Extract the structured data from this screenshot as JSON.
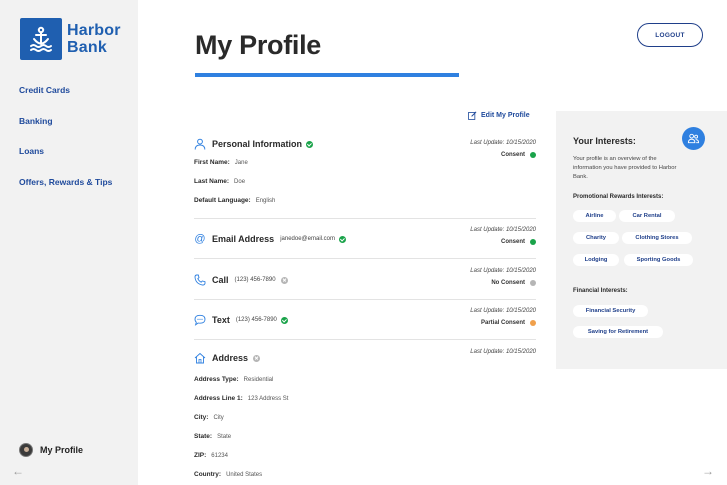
{
  "brand": {
    "line1": "Harbor",
    "line2": "Bank",
    "color": "#1f5fb0"
  },
  "sidebar": {
    "items": [
      {
        "label": "Credit Cards"
      },
      {
        "label": "Banking"
      },
      {
        "label": "Loans"
      },
      {
        "label": "Offers, Rewards & Tips"
      }
    ],
    "profile_label": "My Profile"
  },
  "header": {
    "title": "My Profile",
    "logout_label": "LOGOUT",
    "accent": "#2f80e0"
  },
  "edit_label": "Edit My Profile",
  "sections": {
    "personal": {
      "title": "Personal Information",
      "update": "Last Update: 10/15/2020",
      "consent": "Consent",
      "fields": [
        {
          "label": "First Name:",
          "value": "Jane"
        },
        {
          "label": "Last Name:",
          "value": "Doe"
        },
        {
          "label": "Default Language:",
          "value": "English"
        }
      ]
    },
    "email": {
      "title": "Email Address",
      "value": "janedoe@email.com",
      "update": "Last Update: 10/15/2020",
      "consent": "Consent"
    },
    "call": {
      "title": "Call",
      "value": "(123) 456-7890",
      "update": "Last Update: 10/15/2020",
      "consent": "No Consent"
    },
    "text": {
      "title": "Text",
      "value": "(123) 456-7890",
      "update": "Last Update: 10/15/2020",
      "consent": "Partial Consent"
    },
    "address": {
      "title": "Address",
      "update": "Last Update: 10/15/2020",
      "fields": [
        {
          "label": "Address Type:",
          "value": "Residential"
        },
        {
          "label": "Address Line 1:",
          "value": "123 Address St"
        },
        {
          "label": "City:",
          "value": "City"
        },
        {
          "label": "State:",
          "value": "State"
        },
        {
          "label": "ZIP:",
          "value": "61234"
        },
        {
          "label": "Country:",
          "value": "United States"
        }
      ]
    }
  },
  "status_colors": {
    "consent": "#1aa34a",
    "no_consent": "#b5b5b5",
    "partial": "#f0a04b"
  },
  "interests": {
    "title": "Your Interests:",
    "description": "Your profile is an overview of the information you have provided to Harbor Bank.",
    "promo_label": "Promotional Rewards Interests:",
    "promo": [
      "Airline",
      "Car Rental",
      "Charity",
      "Clothing Stores",
      "Lodging",
      "Sporting Goods"
    ],
    "financial_label": "Financial Interests:",
    "financial": [
      "Financial Security",
      "Saving for Retirement"
    ]
  }
}
